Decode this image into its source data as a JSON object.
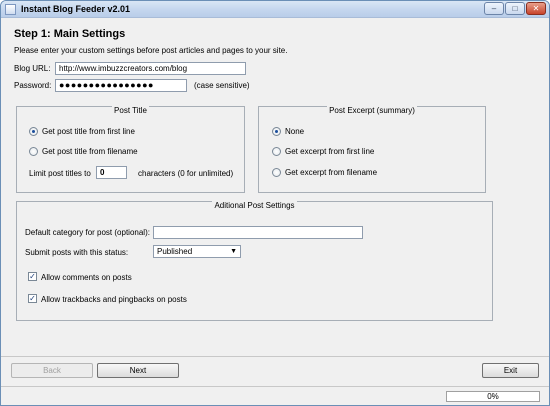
{
  "window": {
    "title": "Instant Blog Feeder v2.01",
    "minimize_glyph": "–",
    "maximize_glyph": "□",
    "close_glyph": "✕"
  },
  "main": {
    "step_title": "Step 1: Main Settings",
    "intro": "Please enter your custom settings before post articles and pages to your site.",
    "blog_url_label": "Blog URL:",
    "blog_url_value": "http://www.imbuzzcreators.com/blog",
    "password_label": "Password:",
    "password_value": "●●●●●●●●●●●●●●●●",
    "password_note": "(case sensitive)"
  },
  "post_title": {
    "legend": "Post Title",
    "options": [
      {
        "label": "Get post title from first line",
        "selected": true
      },
      {
        "label": "Get post title from filename",
        "selected": false
      }
    ],
    "limit_label": "Limit post titles to",
    "limit_value": "0",
    "limit_suffix": "characters (0 for unlimited)"
  },
  "post_excerpt": {
    "legend": "Post Excerpt (summary)",
    "options": [
      {
        "label": "None",
        "selected": true
      },
      {
        "label": "Get excerpt from first line",
        "selected": false
      },
      {
        "label": "Get excerpt from filename",
        "selected": false
      }
    ]
  },
  "additional": {
    "legend": "Aditional Post Settings",
    "category_label": "Default category for post (optional):",
    "category_value": "",
    "status_label": "Submit posts with this status:",
    "status_value": "Published",
    "allow_comments_label": "Allow comments on posts",
    "allow_comments_checked": true,
    "allow_trackbacks_label": "Allow trackbacks and pingbacks on posts",
    "allow_trackbacks_checked": true,
    "check_glyph": "✓"
  },
  "buttons": {
    "back": "Back",
    "next": "Next",
    "exit": "Exit"
  },
  "status": {
    "progress_text": "0%",
    "progress_value": 0
  },
  "colors": {
    "accent_radio": "#1c4f9c",
    "titlebar": "#c4d6ee"
  },
  "icons": {
    "app": "window-app-icon",
    "dropdown": "chevron-down-icon"
  }
}
